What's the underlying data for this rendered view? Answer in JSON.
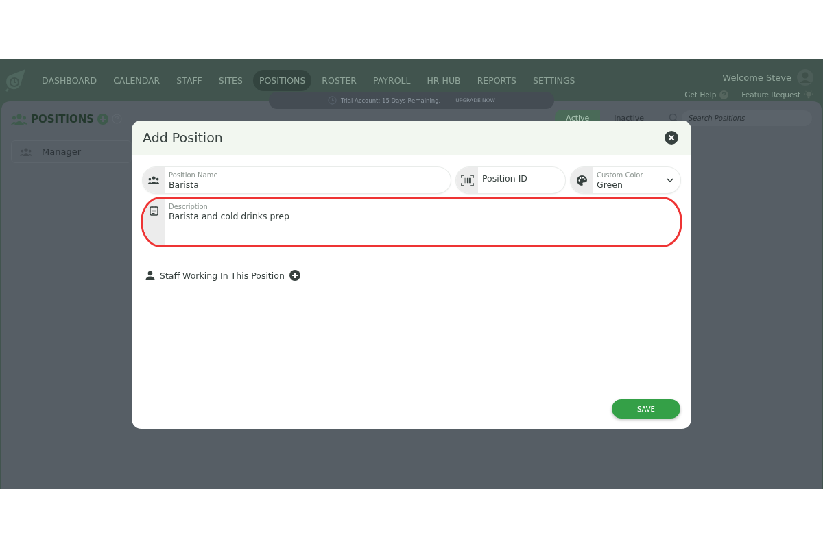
{
  "nav": {
    "items": [
      {
        "label": "DASHBOARD",
        "selected": false
      },
      {
        "label": "CALENDAR",
        "selected": false
      },
      {
        "label": "STAFF",
        "selected": false
      },
      {
        "label": "SITES",
        "selected": false
      },
      {
        "label": "POSITIONS",
        "selected": true
      },
      {
        "label": "ROSTER",
        "selected": false
      },
      {
        "label": "PAYROLL",
        "selected": false
      },
      {
        "label": "HR HUB",
        "selected": false
      },
      {
        "label": "REPORTS",
        "selected": false
      },
      {
        "label": "SETTINGS",
        "selected": false
      }
    ],
    "welcome": "Welcome Steve",
    "help": "Get Help",
    "feature": "Feature Request"
  },
  "trial": {
    "text": "Trial Account: 15 Days Remaining.",
    "action": "UPGRADE NOW"
  },
  "page": {
    "title": "POSITIONS",
    "filters": [
      {
        "label": "Active",
        "selected": true
      },
      {
        "label": "Inactive",
        "selected": false
      }
    ],
    "search": {
      "placeholder": "Search Positions"
    },
    "positions": [
      "Manager"
    ]
  },
  "dialog": {
    "title": "Add Position",
    "fields": [
      {
        "kind": "text",
        "label": "Position Name",
        "value": "Barista"
      },
      {
        "kind": "text",
        "placeholder": "Position ID"
      },
      {
        "kind": "select",
        "label": "Custom Color",
        "value": "Green"
      }
    ],
    "description": {
      "label": "Description",
      "value": "Barista and cold drinks prep",
      "highlighted": true
    },
    "staff_heading": "Staff Working In This Position",
    "save": "SAVE"
  }
}
